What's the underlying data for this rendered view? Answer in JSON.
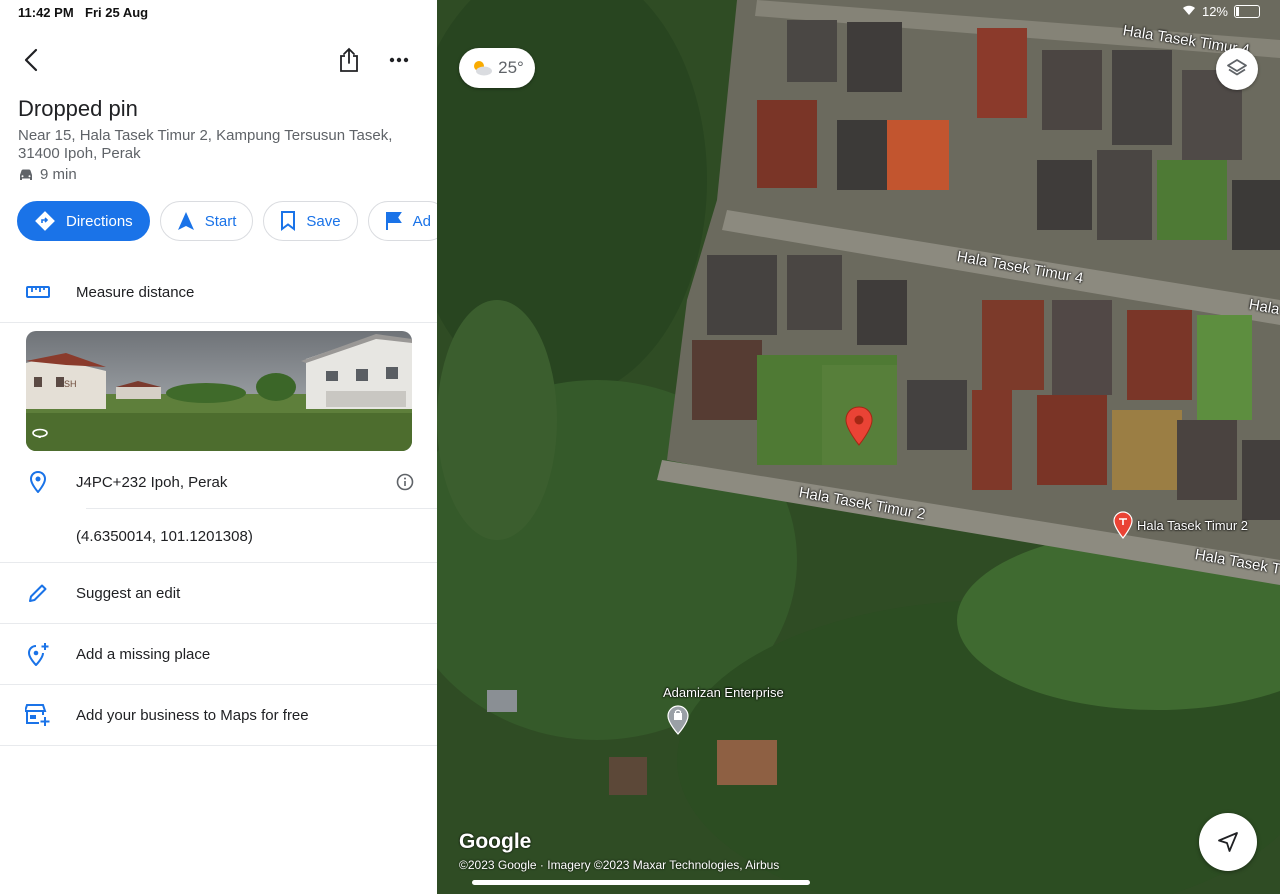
{
  "status": {
    "time": "11:42 PM",
    "date": "Fri 25 Aug",
    "battery": "12%"
  },
  "panel": {
    "title": "Dropped pin",
    "address": "Near 15, Hala Tasek Timur 2, Kampung Tersusun Tasek, 31400 Ipoh, Perak",
    "drive_time": "9 min",
    "actions": {
      "directions": "Directions",
      "start": "Start",
      "save": "Save",
      "add_label": "Ad"
    },
    "measure": "Measure distance",
    "plus_code": "J4PC+232 Ipoh, Perak",
    "coordinates": "(4.6350014, 101.1201308)",
    "suggest_edit": "Suggest an edit",
    "add_missing": "Add a missing place",
    "add_business": "Add your business to Maps for free",
    "photo_badge": "SH"
  },
  "map": {
    "weather_temp": "25°",
    "streets": {
      "timur4_top": "Hala Tasek Timur 4",
      "timur4_mid": "Hala Tasek Timur 4",
      "hala_right": "Hala",
      "timur2": "Hala Tasek Timur 2",
      "timur2_right": "Hala Tasek T"
    },
    "place_timur2": "Hala Tasek Timur 2",
    "place_adamizan": "Adamizan Enterprise",
    "logo": "Google",
    "copyright": "©2023 Google · Imagery ©2023 Maxar Technologies, Airbus"
  },
  "colors": {
    "accent": "#1a73e8",
    "pin": "#ea4335"
  }
}
